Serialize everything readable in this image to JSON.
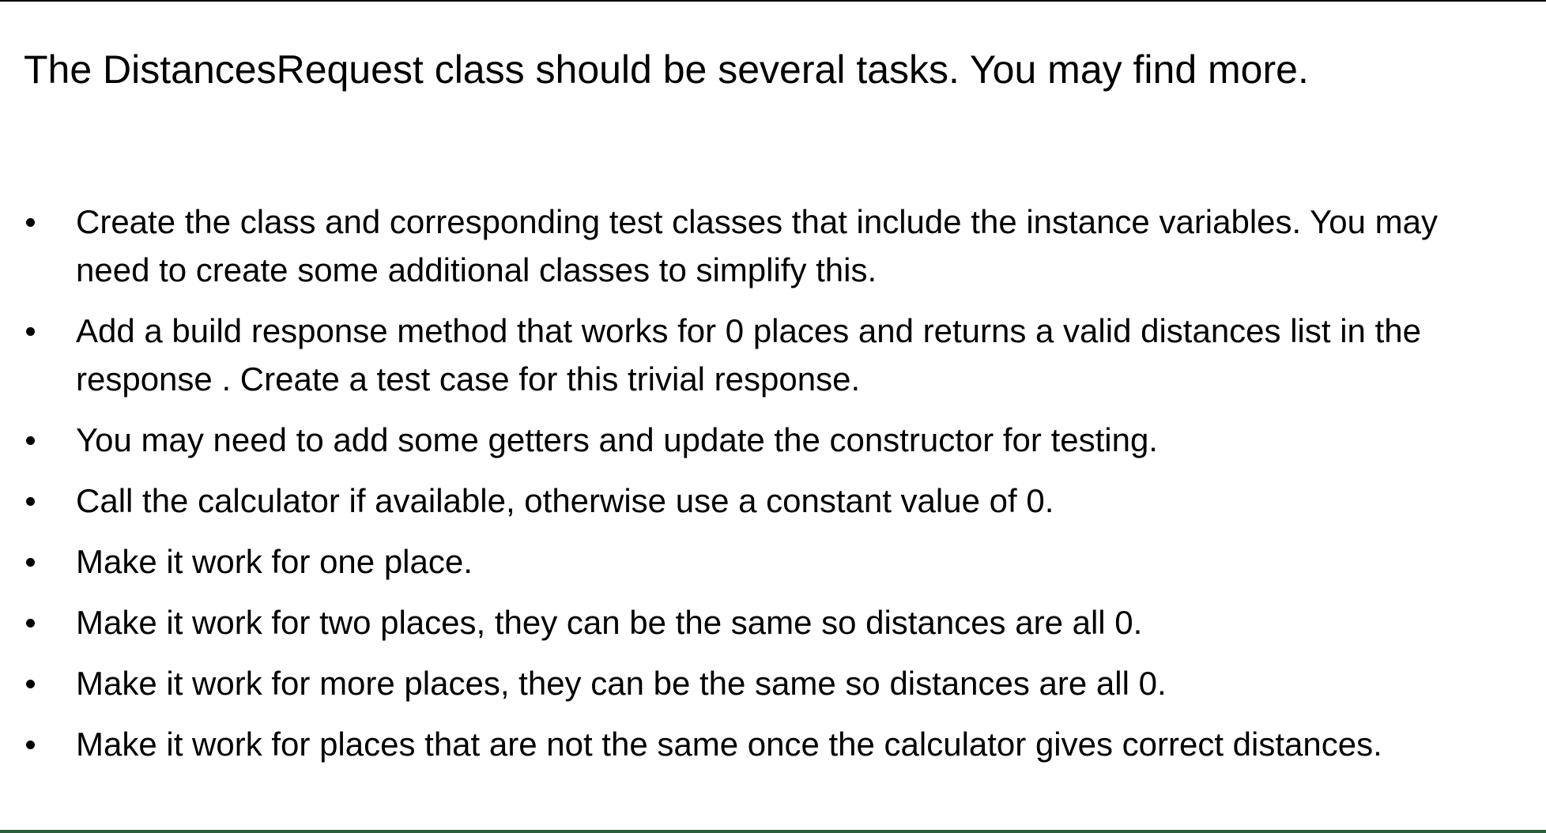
{
  "slide": {
    "heading": "The DistancesRequest class should be several tasks.  You may find more.",
    "bullets": [
      "Create the class and corresponding test classes that include the instance variables.  You may need to create some additional classes to simplify this.",
      "Add a build response method that works for 0 places and returns a valid distances list in the response .  Create a test case for this trivial response.",
      "You may need to add some getters and update the constructor for testing.",
      "Call the calculator if available, otherwise use a constant value of 0.",
      "Make it work for one place.",
      "Make it work for two places, they can be the same so distances are all 0.",
      "Make it work for more places, they can be the same so distances are all 0.",
      "Make it work for places that are not the same once the calculator gives correct distances."
    ]
  }
}
